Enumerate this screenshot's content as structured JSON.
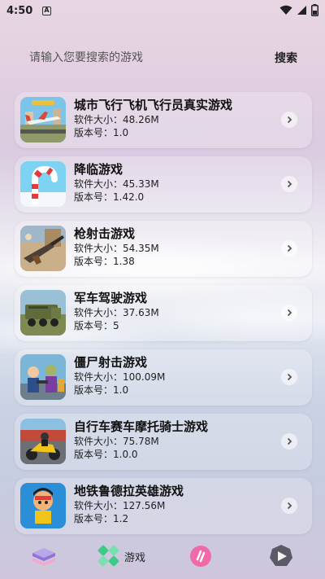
{
  "status_bar": {
    "time": "4:50",
    "badge": "A"
  },
  "search": {
    "placeholder": "请输入您要搜索的游戏",
    "button_label": "搜索"
  },
  "games": [
    {
      "title": "城市飞行飞机飞行员真实游戏",
      "size": "软件大小：48.26M",
      "version": "版本号：1.0"
    },
    {
      "title": "降临游戏",
      "size": "软件大小：45.33M",
      "version": "版本号：1.42.0"
    },
    {
      "title": "枪射击游戏",
      "size": "软件大小：54.35M",
      "version": "版本号：1.38"
    },
    {
      "title": "军车驾驶游戏",
      "size": "软件大小：37.63M",
      "version": "版本号：5"
    },
    {
      "title": "僵尸射击游戏",
      "size": "软件大小：100.09M",
      "version": "版本号：1.0"
    },
    {
      "title": "自行车赛车摩托骑士游戏",
      "size": "软件大小：75.78M",
      "version": "版本号：1.0.0"
    },
    {
      "title": "地铁鲁德拉英雄游戏",
      "size": "软件大小：127.56M",
      "version": "版本号：1.2"
    }
  ],
  "bottom_nav": {
    "items": [
      {
        "icon": "layers-icon",
        "label": ""
      },
      {
        "icon": "gamepad-icon",
        "label": "游戏"
      },
      {
        "icon": "swap-icon",
        "label": ""
      },
      {
        "icon": "play-icon",
        "label": ""
      }
    ]
  }
}
